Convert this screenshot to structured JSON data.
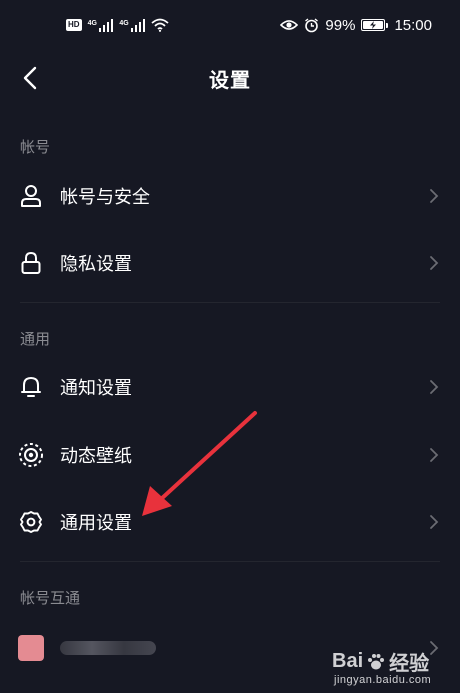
{
  "status_bar": {
    "hd": "HD",
    "sim1": "4G",
    "sim2": "4G",
    "battery_percent": "99%",
    "time": "15:00"
  },
  "nav": {
    "title": "设置"
  },
  "sections": [
    {
      "header": "帐号"
    },
    {
      "header": "通用"
    },
    {
      "header": "帐号互通"
    }
  ],
  "rows": {
    "account_security": "帐号与安全",
    "privacy": "隐私设置",
    "notification": "通知设置",
    "live_wallpaper": "动态壁纸",
    "general": "通用设置"
  },
  "watermark": {
    "brand": "Bai",
    "brand_suffix": "经验",
    "url": "jingyan.baidu.com"
  },
  "annotation_color": "#e8323c"
}
